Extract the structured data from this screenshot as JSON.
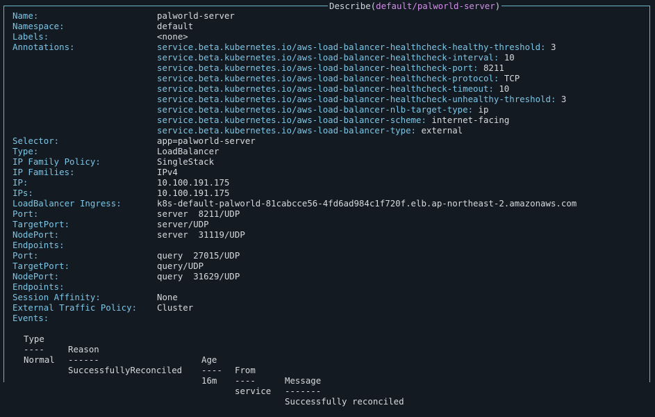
{
  "title": {
    "prefix": "Describe(",
    "ctx": "default/palworld-server",
    "suffix": ")"
  },
  "fields": [
    {
      "key": "Name:",
      "value": "palworld-server"
    },
    {
      "key": "Namespace:",
      "value": "default"
    },
    {
      "key": "Labels:",
      "value": "<none>"
    }
  ],
  "annotations_label": "Annotations:",
  "annotations": [
    {
      "k": "service.beta.kubernetes.io/aws-load-balancer-healthcheck-healthy-threshold:",
      "v": " 3"
    },
    {
      "k": "service.beta.kubernetes.io/aws-load-balancer-healthcheck-interval:",
      "v": " 10"
    },
    {
      "k": "service.beta.kubernetes.io/aws-load-balancer-healthcheck-port:",
      "v": " 8211"
    },
    {
      "k": "service.beta.kubernetes.io/aws-load-balancer-healthcheck-protocol:",
      "v": " TCP"
    },
    {
      "k": "service.beta.kubernetes.io/aws-load-balancer-healthcheck-timeout:",
      "v": " 10"
    },
    {
      "k": "service.beta.kubernetes.io/aws-load-balancer-healthcheck-unhealthy-threshold:",
      "v": " 3"
    },
    {
      "k": "service.beta.kubernetes.io/aws-load-balancer-nlb-target-type:",
      "v": " ip"
    },
    {
      "k": "service.beta.kubernetes.io/aws-load-balancer-scheme:",
      "v": " internet-facing"
    },
    {
      "k": "service.beta.kubernetes.io/aws-load-balancer-type:",
      "v": " external"
    }
  ],
  "fields2": [
    {
      "key": "Selector:",
      "value": "app=palworld-server"
    },
    {
      "key": "Type:",
      "value": "LoadBalancer"
    },
    {
      "key": "IP Family Policy:",
      "value": "SingleStack"
    },
    {
      "key": "IP Families:",
      "value": "IPv4"
    },
    {
      "key": "IP:",
      "value": "10.100.191.175"
    },
    {
      "key": "IPs:",
      "value": "10.100.191.175"
    },
    {
      "key": "LoadBalancer Ingress:",
      "value": "k8s-default-palworld-81cabcce56-4fd6ad984c1f720f.elb.ap-northeast-2.amazonaws.com"
    },
    {
      "key": "Port:",
      "value": "server  8211/UDP"
    },
    {
      "key": "TargetPort:",
      "value": "server/UDP"
    },
    {
      "key": "NodePort:",
      "value": "server  31119/UDP"
    },
    {
      "key": "Endpoints:",
      "value": ""
    },
    {
      "key": "Port:",
      "value": "query  27015/UDP"
    },
    {
      "key": "TargetPort:",
      "value": "query/UDP"
    },
    {
      "key": "NodePort:",
      "value": "query  31629/UDP"
    },
    {
      "key": "Endpoints:",
      "value": ""
    },
    {
      "key": "Session Affinity:",
      "value": "None"
    },
    {
      "key": "External Traffic Policy:",
      "value": "Cluster"
    },
    {
      "key": "Events:",
      "value": ""
    }
  ],
  "events": {
    "headers": [
      "Type",
      "Reason",
      "Age",
      "From",
      "Message"
    ],
    "dashes": [
      "----",
      "------",
      "----",
      "----",
      "-------"
    ],
    "rows": [
      [
        "Normal",
        "SuccessfullyReconciled",
        "16m",
        "service",
        "Successfully reconciled"
      ]
    ]
  }
}
